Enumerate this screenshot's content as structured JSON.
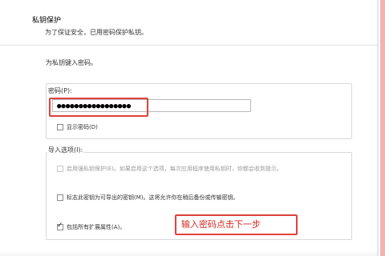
{
  "header": {
    "title": "私钥保护",
    "subtitle": "为了保证安全，已用密码保护私钥。"
  },
  "intro": "为私钥键入密码。",
  "password_group": {
    "label": "密码(P):",
    "value": "●●●●●●●●●●●●●●●●●",
    "show_password_label": "显示密码(D)",
    "show_password_checked": false
  },
  "import_options": {
    "label": "导入选项(I):",
    "items": [
      {
        "label": "启用强私钥保护(E)。如果启用这个选项，每次应用程序使用私钥时，你都会收到提示。",
        "checked": false,
        "enabled": false
      },
      {
        "label": "标志此密钥为可导出的密钥(M)。这将允许你在稍后备份或传输密钥。",
        "checked": false,
        "enabled": true
      },
      {
        "label": "包括所有扩展属性(A)。",
        "checked": true,
        "enabled": true
      }
    ]
  },
  "callout": {
    "text": "输入密码点击下一步",
    "color": "#e0423a"
  }
}
